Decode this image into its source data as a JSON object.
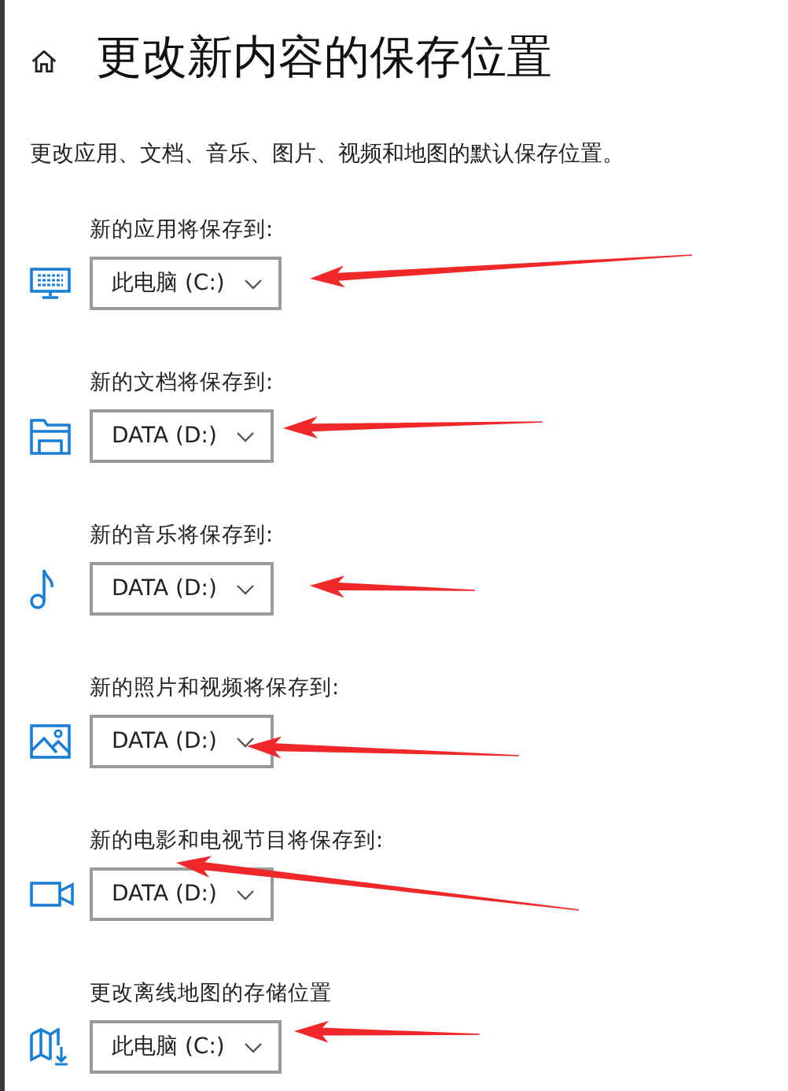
{
  "page": {
    "title": "更改新内容的保存位置",
    "description": "更改应用、文档、音乐、图片、视频和地图的默认保存位置。"
  },
  "sections": [
    {
      "kind": "apps",
      "label": "新的应用将保存到:",
      "value": "此电脑 (C:)",
      "arrow": true
    },
    {
      "kind": "documents",
      "label": "新的文档将保存到:",
      "value": "DATA (D:)",
      "arrow": true
    },
    {
      "kind": "music",
      "label": "新的音乐将保存到:",
      "value": "DATA (D:)",
      "arrow": true
    },
    {
      "kind": "photos",
      "label": "新的照片和视频将保存到:",
      "value": "DATA (D:)",
      "arrow": true
    },
    {
      "kind": "movies",
      "label": "新的电影和电视节目将保存到:",
      "value": "DATA (D:)",
      "arrow": true
    },
    {
      "kind": "maps",
      "label": "更改离线地图的存储位置",
      "value": "此电脑 (C:)",
      "arrow": true
    }
  ]
}
